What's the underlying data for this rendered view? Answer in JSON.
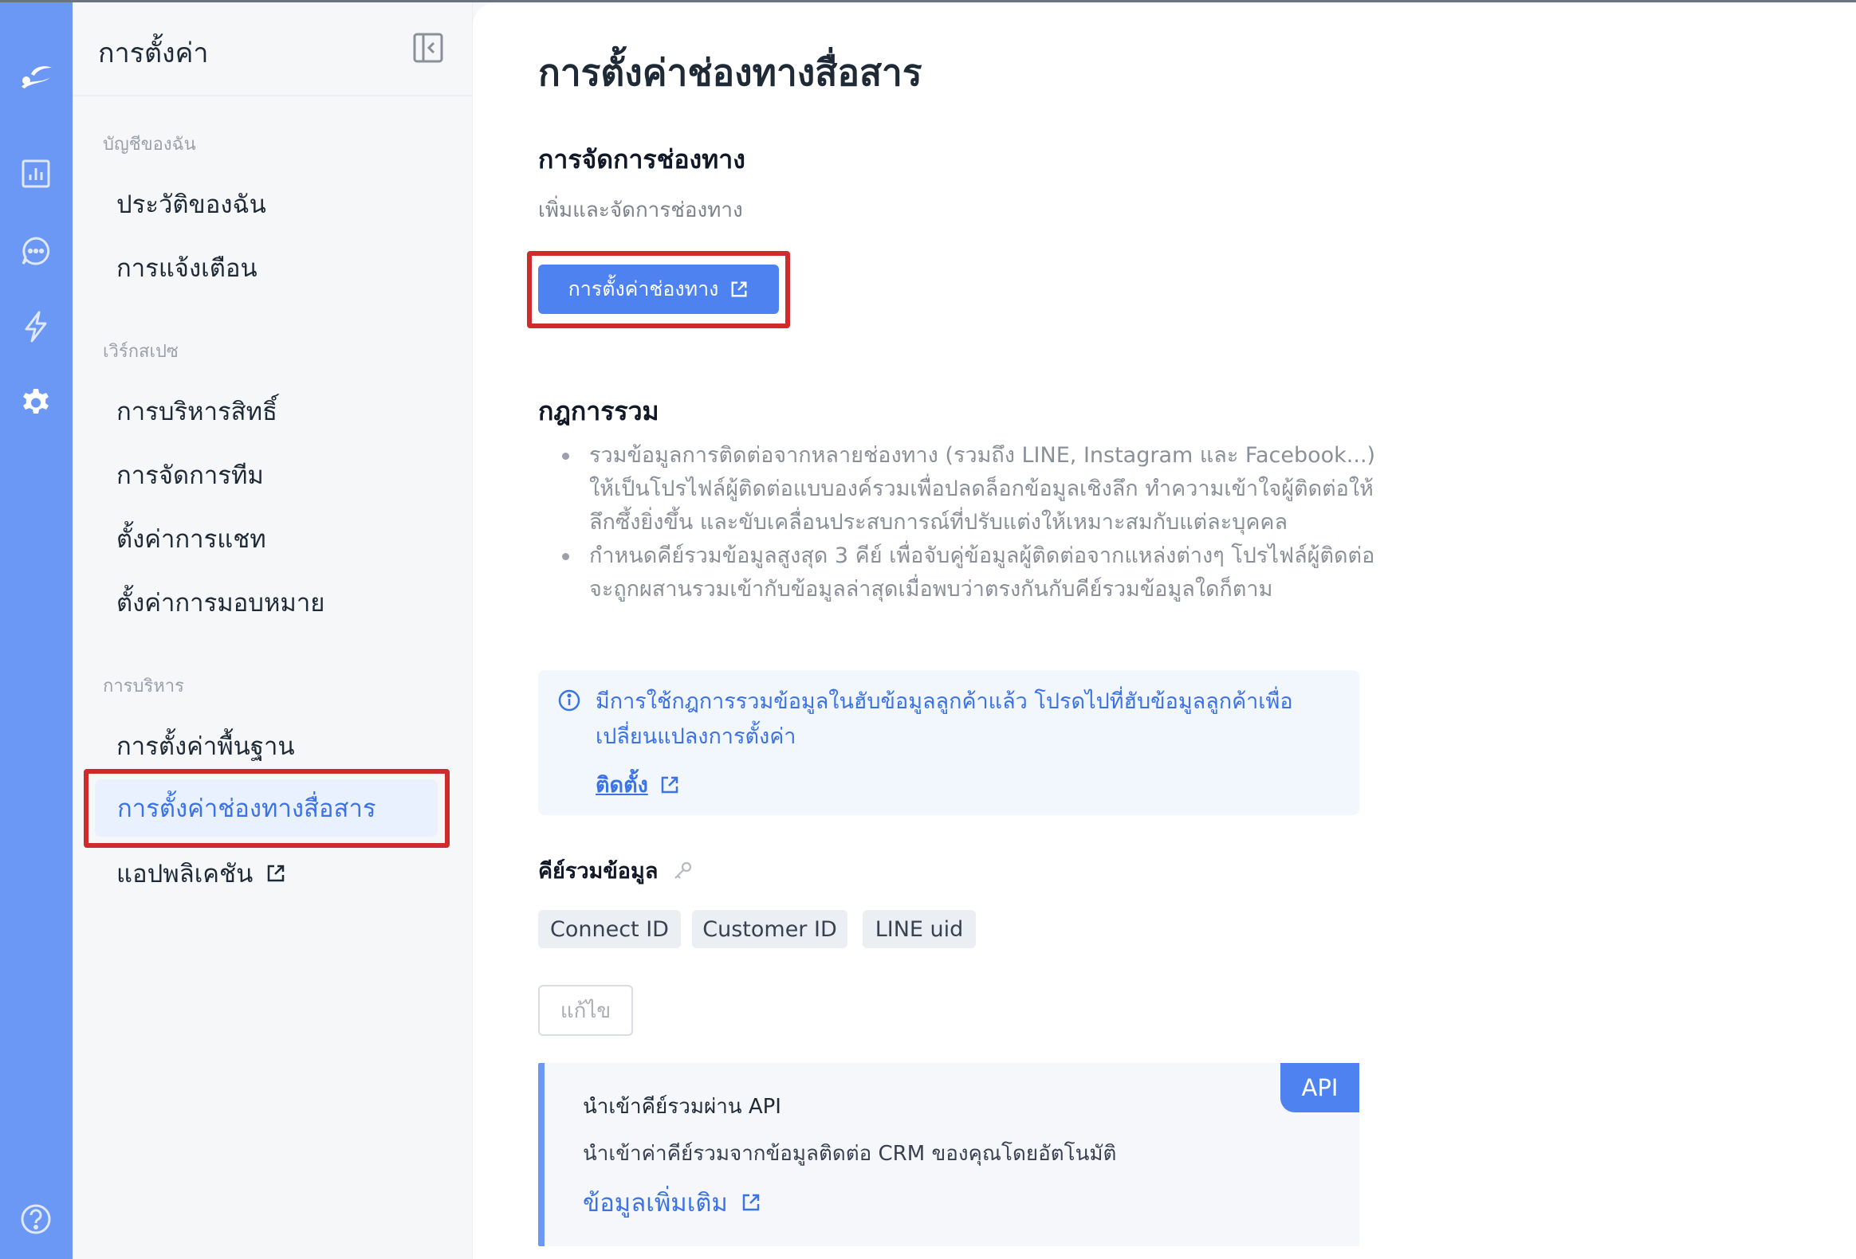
{
  "sidebar": {
    "title": "การตั้งค่า",
    "groups": [
      {
        "label": "บัญชีของฉัน",
        "items": [
          "ประวัติของฉัน",
          "การแจ้งเตือน"
        ]
      },
      {
        "label": "เวิร์กสเปซ",
        "items": [
          "การบริหารสิทธิ์",
          "การจัดการทีม",
          "ตั้งค่าการแชท",
          "ตั้งค่าการมอบหมาย"
        ]
      },
      {
        "label": "การบริหาร",
        "items": [
          "การตั้งค่าพื้นฐาน",
          "การตั้งค่าช่องทางสื่อสาร",
          "แอปพลิเคชัน"
        ]
      }
    ],
    "active_item": "การตั้งค่าช่องทางสื่อสาร"
  },
  "rail": {
    "icons": [
      "logo-icon",
      "analytics-icon",
      "chat-icon",
      "automation-icon",
      "settings-icon",
      "help-icon"
    ]
  },
  "main": {
    "page_title": "การตั้งค่าช่องทางสื่อสาร",
    "channel": {
      "title": "การจัดการช่องทาง",
      "subtitle": "เพิ่มและจัดการช่องทาง",
      "button_label": "การตั้งค่าช่องทาง"
    },
    "merge": {
      "title": "กฎการรวม",
      "rules": [
        "รวมข้อมูลการติดต่อจากหลายช่องทาง (รวมถึง LINE, Instagram และ Facebook...) ให้เป็นโปรไฟล์ผู้ติดต่อแบบองค์รวมเพื่อปลดล็อกข้อมูลเชิงลึก ทำความเข้าใจผู้ติดต่อให้ลึกซึ้งยิ่งขึ้น และขับเคลื่อนประสบการณ์ที่ปรับแต่งให้เหมาะสมกับแต่ละบุคคล",
        "กำหนดคีย์รวมข้อมูลสูงสุด 3 คีย์ เพื่อจับคู่ข้อมูลผู้ติดต่อจากแหล่งต่างๆ โปรไฟล์ผู้ติดต่อจะถูกผสานรวมเข้ากับข้อมูลล่าสุดเมื่อพบว่าตรงกันกับคีย์รวมข้อมูลใดก็ตาม"
      ],
      "notice_text": "มีการใช้กฎการรวมข้อมูลในฮับข้อมูลลูกค้าแล้ว โปรดไปที่ฮับข้อมูลลูกค้าเพื่อเปลี่ยนแปลงการตั้งค่า",
      "notice_link": "ติดตั้ง",
      "keys_label": "คีย์รวมข้อมูล",
      "keys": [
        "Connect ID",
        "Customer ID",
        "LINE uid"
      ],
      "edit_label": "แก้ไข"
    },
    "api": {
      "badge": "API",
      "title": "นำเข้าคีย์รวมผ่าน API",
      "description": "นำเข้าค่าคีย์รวมจากข้อมูลติดต่อ CRM ของคุณโดยอัตโนมัติ",
      "link": "ข้อมูลเพิ่มเติม"
    }
  },
  "colors": {
    "rail": "#6b98f4",
    "primary": "#4e82f0",
    "accent_text": "#3b73e6",
    "highlight_frame": "#cf2b2b"
  }
}
